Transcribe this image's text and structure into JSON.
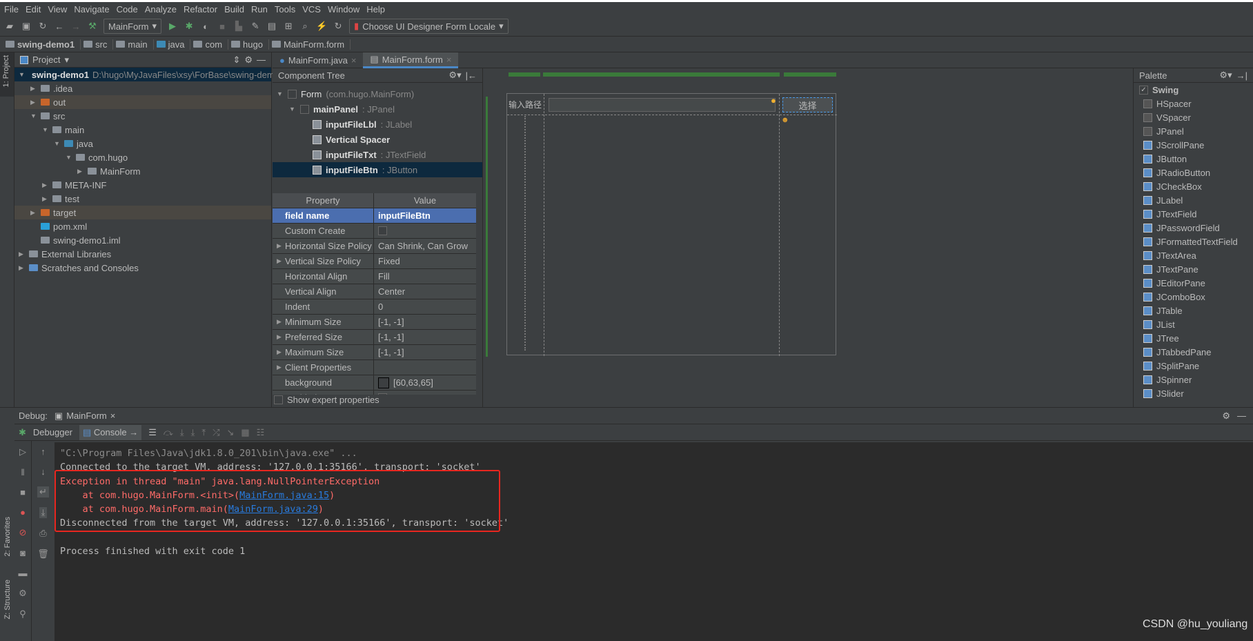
{
  "menu": [
    "File",
    "Edit",
    "View",
    "Navigate",
    "Code",
    "Analyze",
    "Refactor",
    "Build",
    "Run",
    "Tools",
    "VCS",
    "Window",
    "Help"
  ],
  "toolbar": {
    "run_config": "MainForm",
    "locale": "Choose UI Designer Form Locale"
  },
  "breadcrumb": [
    "swing-demo1",
    "src",
    "main",
    "java",
    "com",
    "hugo",
    "MainForm.form"
  ],
  "left_stripe": {
    "project": "1: Project",
    "favorites": "2: Favorites",
    "structure": "Z: Structure"
  },
  "project": {
    "title": "Project",
    "root": "swing-demo1",
    "root_path": "D:\\hugo\\MyJavaFiles\\xsy\\ForBase\\swing-dem",
    "items": [
      {
        "label": ".idea",
        "depth": 1,
        "arrow": "▶",
        "kind": "folder"
      },
      {
        "label": "out",
        "depth": 1,
        "arrow": "▶",
        "kind": "excluded"
      },
      {
        "label": "src",
        "depth": 1,
        "arrow": "▼",
        "kind": "folder"
      },
      {
        "label": "main",
        "depth": 2,
        "arrow": "▼",
        "kind": "folder"
      },
      {
        "label": "java",
        "depth": 3,
        "arrow": "▼",
        "kind": "source"
      },
      {
        "label": "com.hugo",
        "depth": 4,
        "arrow": "▼",
        "kind": "package"
      },
      {
        "label": "MainForm",
        "depth": 5,
        "arrow": "▶",
        "kind": "form"
      },
      {
        "label": "META-INF",
        "depth": 2,
        "arrow": "▶",
        "kind": "folder"
      },
      {
        "label": "test",
        "depth": 2,
        "arrow": "▶",
        "kind": "folder"
      },
      {
        "label": "target",
        "depth": 1,
        "arrow": "▶",
        "kind": "excluded"
      },
      {
        "label": "pom.xml",
        "depth": 1,
        "arrow": "",
        "kind": "maven"
      },
      {
        "label": "swing-demo1.iml",
        "depth": 1,
        "arrow": "",
        "kind": "file"
      },
      {
        "label": "External Libraries",
        "depth": 0,
        "arrow": "▶",
        "kind": "lib"
      },
      {
        "label": "Scratches and Consoles",
        "depth": 0,
        "arrow": "▶",
        "kind": "scratch"
      }
    ]
  },
  "editor_tabs": [
    {
      "label": "MainForm.java",
      "active": false
    },
    {
      "label": "MainForm.form",
      "active": true
    }
  ],
  "component_tree": {
    "title": "Component Tree",
    "items": [
      {
        "name": "Form",
        "type": "(com.hugo.MainForm)",
        "depth": 0,
        "arrow": "▼"
      },
      {
        "name": "mainPanel",
        "type": ": JPanel",
        "depth": 1,
        "arrow": "▼"
      },
      {
        "name": "inputFileLbl",
        "type": ": JLabel",
        "depth": 2,
        "arrow": ""
      },
      {
        "name": "Vertical Spacer",
        "type": "",
        "depth": 2,
        "arrow": ""
      },
      {
        "name": "inputFileTxt",
        "type": ": JTextField",
        "depth": 2,
        "arrow": ""
      },
      {
        "name": "inputFileBtn",
        "type": ": JButton",
        "depth": 2,
        "arrow": "",
        "selected": true
      }
    ]
  },
  "properties": {
    "header": [
      "Property",
      "Value"
    ],
    "rows": [
      {
        "k": "field name",
        "v": "inputFileBtn",
        "selected": true
      },
      {
        "k": "Custom Create",
        "v": "",
        "checkbox": true
      },
      {
        "k": "Horizontal Size Policy",
        "v": "Can Shrink, Can Grow",
        "expand": true
      },
      {
        "k": "Vertical Size Policy",
        "v": "Fixed",
        "expand": true
      },
      {
        "k": "Horizontal Align",
        "v": "Fill"
      },
      {
        "k": "Vertical Align",
        "v": "Center"
      },
      {
        "k": "Indent",
        "v": "0"
      },
      {
        "k": "Minimum Size",
        "v": "[-1, -1]",
        "expand": true
      },
      {
        "k": "Preferred Size",
        "v": "[-1, -1]",
        "expand": true
      },
      {
        "k": "Maximum Size",
        "v": "[-1, -1]",
        "expand": true
      },
      {
        "k": "Client Properties",
        "v": "",
        "expand": true
      },
      {
        "k": "background",
        "v": "[60,63,65]",
        "swatch": "#3c3f41"
      },
      {
        "k": "enabled",
        "v": "",
        "checkbox": true
      }
    ],
    "show_expert": "Show expert properties"
  },
  "form": {
    "label": "输入路径",
    "button": "选择"
  },
  "palette": {
    "title": "Palette",
    "group": "Swing",
    "items": [
      "HSpacer",
      "VSpacer",
      "JPanel",
      "JScrollPane",
      "JButton",
      "JRadioButton",
      "JCheckBox",
      "JLabel",
      "JTextField",
      "JPasswordField",
      "JFormattedTextField",
      "JTextArea",
      "JTextPane",
      "JEditorPane",
      "JComboBox",
      "JTable",
      "JList",
      "JTree",
      "JTabbedPane",
      "JSplitPane",
      "JSpinner",
      "JSlider"
    ]
  },
  "debug": {
    "label": "Debug:",
    "tab": "MainForm",
    "debugger_tab": "Debugger",
    "console_tab": "Console"
  },
  "console": [
    {
      "parts": [
        {
          "t": "\"C:\\Program Files\\Java\\jdk1.8.0_201\\bin\\java.exe\" ...",
          "c": "grey"
        }
      ]
    },
    {
      "parts": [
        {
          "t": "Connected to the target VM, address: '127.0.0.1:35166', transport: 'socket'",
          "c": "norm"
        }
      ]
    },
    {
      "parts": [
        {
          "t": "Exception in thread \"main\" java.lang.NullPointerException",
          "c": "err"
        }
      ]
    },
    {
      "parts": [
        {
          "t": "    at com.hugo.MainForm.<init>(",
          "c": "err"
        },
        {
          "t": "MainForm.java:15",
          "c": "link"
        },
        {
          "t": ")",
          "c": "err"
        }
      ]
    },
    {
      "parts": [
        {
          "t": "    at com.hugo.MainForm.main(",
          "c": "err"
        },
        {
          "t": "MainForm.java:29",
          "c": "link"
        },
        {
          "t": ")",
          "c": "err"
        }
      ]
    },
    {
      "parts": [
        {
          "t": "Disconnected from the target VM, address: '127.0.0.1:35166', transport: 'socket'",
          "c": "norm"
        }
      ]
    },
    {
      "parts": [
        {
          "t": "",
          "c": "norm"
        }
      ]
    },
    {
      "parts": [
        {
          "t": "Process finished with exit code 1",
          "c": "norm"
        }
      ]
    }
  ],
  "highlight_color": "#e8261f",
  "watermark": "CSDN @hu_youliang"
}
